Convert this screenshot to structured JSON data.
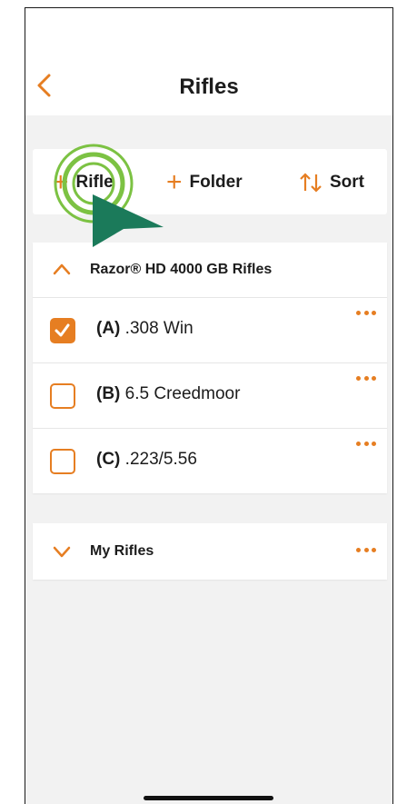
{
  "header": {
    "title": "Rifles"
  },
  "toolbar": {
    "rifle_label": "Rifle",
    "folder_label": "Folder",
    "sort_label": "Sort"
  },
  "groups": [
    {
      "title": "Razor® HD 4000 GB Rifles",
      "expanded": true,
      "items": [
        {
          "prefix": "(A)",
          "label": ".308 Win",
          "checked": true
        },
        {
          "prefix": "(B)",
          "label": "6.5 Creedmoor",
          "checked": false
        },
        {
          "prefix": "(C)",
          "label": ".223/5.56",
          "checked": false
        }
      ]
    },
    {
      "title": "My Rifles",
      "expanded": false
    }
  ],
  "colors": {
    "accent": "#e67e22",
    "tap_ring": "#7cc243",
    "cursor": "#1b7a5a"
  }
}
